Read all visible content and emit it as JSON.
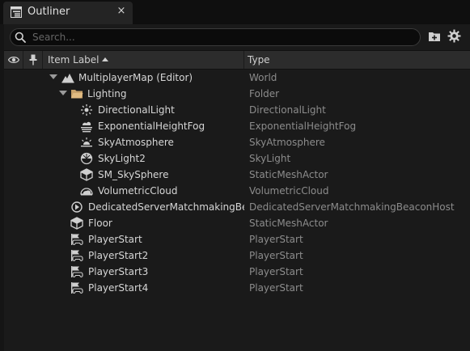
{
  "tab": {
    "title": "Outliner",
    "close_label": "×"
  },
  "search": {
    "placeholder": "Search..."
  },
  "columns": {
    "item_label": "Item Label",
    "type": "Type"
  },
  "rows": [
    {
      "label": "MultiplayerMap (Editor)",
      "type": "World",
      "icon": "world-icon",
      "expanded": true
    },
    {
      "label": "Lighting",
      "type": "Folder",
      "icon": "folder-icon",
      "expanded": true
    },
    {
      "label": "DirectionalLight",
      "type": "DirectionalLight",
      "icon": "directional-light-icon"
    },
    {
      "label": "ExponentialHeightFog",
      "type": "ExponentialHeightFog",
      "icon": "height-fog-icon"
    },
    {
      "label": "SkyAtmosphere",
      "type": "SkyAtmosphere",
      "icon": "sky-atmosphere-icon"
    },
    {
      "label": "SkyLight2",
      "type": "SkyLight",
      "icon": "sky-light-icon"
    },
    {
      "label": "SM_SkySphere",
      "type": "StaticMeshActor",
      "icon": "static-mesh-icon"
    },
    {
      "label": "VolumetricCloud",
      "type": "VolumetricCloud",
      "icon": "volumetric-cloud-icon"
    },
    {
      "label": "DedicatedServerMatchmakingBe",
      "type": "DedicatedServerMatchmakingBeaconHost",
      "icon": "actor-icon"
    },
    {
      "label": "Floor",
      "type": "StaticMeshActor",
      "icon": "static-mesh-icon"
    },
    {
      "label": "PlayerStart",
      "type": "PlayerStart",
      "icon": "player-start-icon"
    },
    {
      "label": "PlayerStart2",
      "type": "PlayerStart",
      "icon": "player-start-icon"
    },
    {
      "label": "PlayerStart3",
      "type": "PlayerStart",
      "icon": "player-start-icon"
    },
    {
      "label": "PlayerStart4",
      "type": "PlayerStart",
      "icon": "player-start-icon"
    }
  ],
  "colors": {
    "background": "#151515",
    "panel": "#1a1a1a",
    "header": "#2c2c2c",
    "folder": "#c8a26b",
    "label_text": "#d6d6d6",
    "type_text": "#8c8c8c"
  }
}
